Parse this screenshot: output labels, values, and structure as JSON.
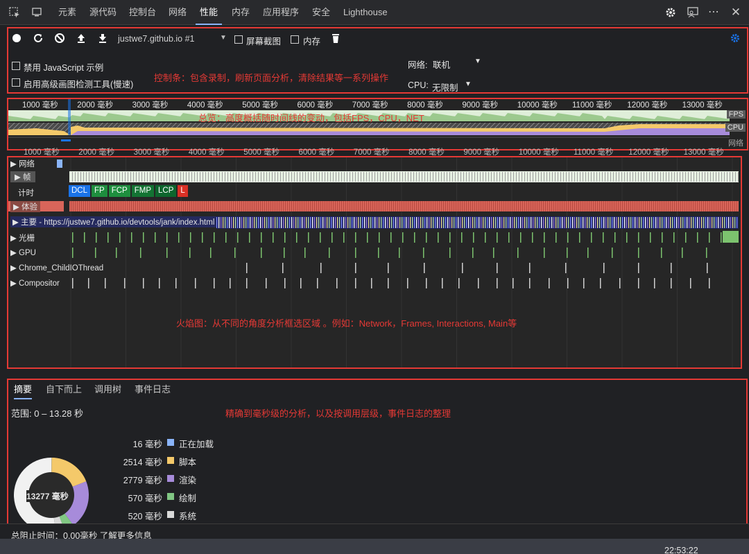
{
  "tabs": {
    "elements": "元素",
    "sources": "源代码",
    "console": "控制台",
    "network": "网络",
    "performance": "性能",
    "memory": "内存",
    "application": "应用程序",
    "security": "安全",
    "lighthouse": "Lighthouse"
  },
  "controls": {
    "profile_select": "justwe7.github.io #1",
    "screenshots_label": "屏幕截图",
    "memory_label": "内存",
    "disable_js_label": "禁用 JavaScript 示例",
    "paint_instrumentation_label": "启用高级画图检测工具(慢速)",
    "network_label": "网络:",
    "network_value": "联机",
    "cpu_label": "CPU:",
    "cpu_value": "无限制",
    "annotation": "控制条：包含录制，刷新页面分析，清除结果等一系列操作"
  },
  "overview": {
    "ticks_top": [
      "1000 毫秒",
      "2000 毫秒",
      "3000 毫秒",
      "4000 毫秒",
      "5000 毫秒",
      "6000 毫秒",
      "7000 毫秒",
      "8000 毫秒",
      "9000 毫秒",
      "10000 毫秒",
      "11000 毫秒",
      "12000 毫秒",
      "13000 毫秒"
    ],
    "ticks_bottom": [
      "1000 毫秒",
      "2000 毫秒",
      "3000 毫秒",
      "4000 毫秒",
      "5000 毫秒",
      "6000 毫秒",
      "7000 毫秒",
      "8000 毫秒",
      "9000 毫秒",
      "10000 毫秒",
      "11000 毫秒",
      "12000 毫秒",
      "13000 毫秒"
    ],
    "fps_label": "FPS",
    "cpu_label": "CPU",
    "net_label": "网络",
    "annotation": "总览：高度概括随时间线的变动，包括FPS，CPU，NET",
    "colors": {
      "fps": "#a5d6a7",
      "cpu_script": "#f4c96a",
      "cpu_render": "#a78bda"
    }
  },
  "flame": {
    "tracks": {
      "network": "网络",
      "frames": "帧",
      "timings": "计时",
      "experience": "体验",
      "main": "主要 - https://justwe7.github.io/devtools/jank/index.html",
      "raster": "光栅",
      "gpu": "GPU",
      "childio": "Chrome_ChildIOThread",
      "compositor": "Compositor"
    },
    "timing_tags": [
      {
        "label": "DCL",
        "color": "#1a73e8"
      },
      {
        "label": "FP",
        "color": "#1e8e3e"
      },
      {
        "label": "FCP",
        "color": "#1e8e3e"
      },
      {
        "label": "FMP",
        "color": "#137333"
      },
      {
        "label": "LCP",
        "color": "#0d652d"
      },
      {
        "label": "L",
        "color": "#d93025"
      }
    ],
    "annotation": "火焰图：从不同的角度分析框选区域 。例如：Network，Frames, Interactions, Main等"
  },
  "summary": {
    "tabs": [
      "摘要",
      "自下而上",
      "调用树",
      "事件日志"
    ],
    "range": "范围: 0 – 13.28 秒",
    "annotation": "精确到毫秒级的分析，以及按调用层级，事件日志的整理",
    "total_label": "13277 毫秒",
    "legend": [
      {
        "value": "16 毫秒",
        "name": "正在加载",
        "color": "#8ab4f8"
      },
      {
        "value": "2514 毫秒",
        "name": "脚本",
        "color": "#f4c96a"
      },
      {
        "value": "2779 毫秒",
        "name": "渲染",
        "color": "#a78bda"
      },
      {
        "value": "570 毫秒",
        "name": "绘制",
        "color": "#81c784"
      },
      {
        "value": "520 毫秒",
        "name": "系统",
        "color": "#d9d9d9"
      }
    ],
    "blocking_time": "总阻止时间：0.00毫秒 了解更多信息"
  },
  "taskbar": {
    "clock": "22:53:22"
  }
}
